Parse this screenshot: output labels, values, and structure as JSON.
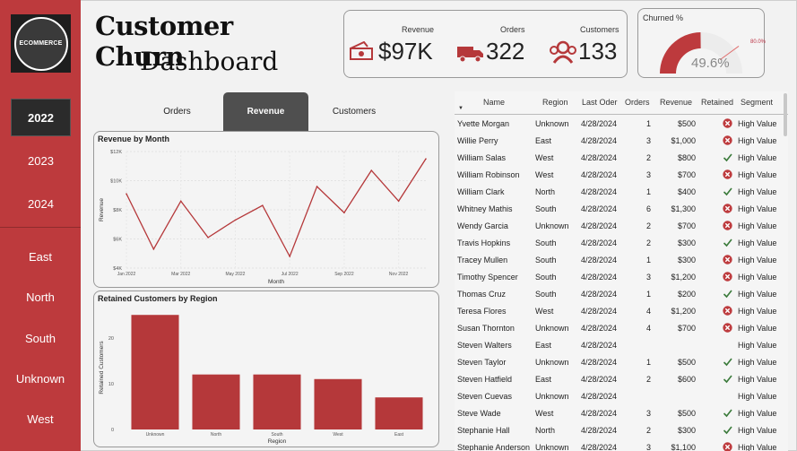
{
  "logo": {
    "text": "ECOMMERCE"
  },
  "sidebar": {
    "years": [
      "2022",
      "2023",
      "2024"
    ],
    "active_year": "2022",
    "regions": [
      "East",
      "North",
      "South",
      "Unknown",
      "West"
    ]
  },
  "title": {
    "main": "Customer Churn",
    "sub": "Dashboard"
  },
  "kpis": {
    "revenue": {
      "label": "Revenue",
      "value": "$97K",
      "icon": "money-icon"
    },
    "orders": {
      "label": "Orders",
      "value": "322",
      "icon": "truck-icon"
    },
    "customers": {
      "label": "Customers",
      "value": "133",
      "icon": "people-icon"
    }
  },
  "churn": {
    "title": "Churned %",
    "value": "49.6%",
    "target_label": "80.0%",
    "fraction": 0.496,
    "target_fraction": 0.8
  },
  "tabs": [
    "Orders",
    "Revenue",
    "Customers"
  ],
  "active_tab": "Revenue",
  "colors": {
    "accent": "#bd3a3d",
    "chart": "#b5383a",
    "check": "#3a7a3a"
  },
  "revenue_chart": {
    "title": "Revenue by Month",
    "chart_data": {
      "type": "line",
      "title": "Revenue by Month",
      "xlabel": "Month",
      "ylabel": "Revenue",
      "x": [
        "Jan 2022",
        "Feb 2022",
        "Mar 2022",
        "Apr 2022",
        "May 2022",
        "Jun 2022",
        "Jul 2022",
        "Aug 2022",
        "Sep 2022",
        "Oct 2022",
        "Nov 2022",
        "Dec 2022"
      ],
      "x_ticks": [
        "Jan 2022",
        "Mar 2022",
        "May 2022",
        "Jul 2022",
        "Sep 2022",
        "Nov 2022"
      ],
      "y_ticks": [
        "$4K",
        "$6K",
        "$8K",
        "$10K",
        "$12K"
      ],
      "values": [
        9100,
        5300,
        8600,
        6100,
        7300,
        8300,
        4800,
        9600,
        7800,
        10700,
        8600,
        11500
      ],
      "ylim": [
        4000,
        12000
      ],
      "grid": true
    }
  },
  "region_chart": {
    "title": "Retained Customers by Region",
    "chart_data": {
      "type": "bar",
      "title": "Retained Customers by Region",
      "xlabel": "Region",
      "ylabel": "Retained Customers",
      "categories": [
        "Unknown",
        "North",
        "South",
        "West",
        "East"
      ],
      "values": [
        25,
        12,
        12,
        11,
        7
      ],
      "y_ticks": [
        "0",
        "10",
        "20"
      ],
      "ylim": [
        0,
        27
      ]
    }
  },
  "table": {
    "headers": [
      "Name",
      "Region",
      "Last Oder",
      "Orders",
      "Revenue",
      "Retained",
      "Segment"
    ],
    "rows": [
      {
        "name": "Yvette Morgan",
        "region": "Unknown",
        "date": "4/28/2024",
        "orders": "1",
        "revenue": "$500",
        "retained": "no",
        "segment": "High Value"
      },
      {
        "name": "Willie Perry",
        "region": "East",
        "date": "4/28/2024",
        "orders": "3",
        "revenue": "$1,000",
        "retained": "no",
        "segment": "High Value"
      },
      {
        "name": "William Salas",
        "region": "West",
        "date": "4/28/2024",
        "orders": "2",
        "revenue": "$800",
        "retained": "yes",
        "segment": "High Value"
      },
      {
        "name": "William Robinson",
        "region": "West",
        "date": "4/28/2024",
        "orders": "3",
        "revenue": "$700",
        "retained": "no",
        "segment": "High Value"
      },
      {
        "name": "William Clark",
        "region": "North",
        "date": "4/28/2024",
        "orders": "1",
        "revenue": "$400",
        "retained": "yes",
        "segment": "High Value"
      },
      {
        "name": "Whitney Mathis",
        "region": "South",
        "date": "4/28/2024",
        "orders": "6",
        "revenue": "$1,300",
        "retained": "no",
        "segment": "High Value"
      },
      {
        "name": "Wendy Garcia",
        "region": "Unknown",
        "date": "4/28/2024",
        "orders": "2",
        "revenue": "$700",
        "retained": "no",
        "segment": "High Value"
      },
      {
        "name": "Travis Hopkins",
        "region": "South",
        "date": "4/28/2024",
        "orders": "2",
        "revenue": "$300",
        "retained": "yes",
        "segment": "High Value"
      },
      {
        "name": "Tracey Mullen",
        "region": "South",
        "date": "4/28/2024",
        "orders": "1",
        "revenue": "$300",
        "retained": "no",
        "segment": "High Value"
      },
      {
        "name": "Timothy Spencer",
        "region": "South",
        "date": "4/28/2024",
        "orders": "3",
        "revenue": "$1,200",
        "retained": "no",
        "segment": "High Value"
      },
      {
        "name": "Thomas Cruz",
        "region": "South",
        "date": "4/28/2024",
        "orders": "1",
        "revenue": "$200",
        "retained": "yes",
        "segment": "High Value"
      },
      {
        "name": "Teresa Flores",
        "region": "West",
        "date": "4/28/2024",
        "orders": "4",
        "revenue": "$1,200",
        "retained": "no",
        "segment": "High Value"
      },
      {
        "name": "Susan Thornton",
        "region": "Unknown",
        "date": "4/28/2024",
        "orders": "4",
        "revenue": "$700",
        "retained": "no",
        "segment": "High Value"
      },
      {
        "name": "Steven Walters",
        "region": "East",
        "date": "4/28/2024",
        "orders": "",
        "revenue": "",
        "retained": "",
        "segment": "High Value"
      },
      {
        "name": "Steven Taylor",
        "region": "Unknown",
        "date": "4/28/2024",
        "orders": "1",
        "revenue": "$500",
        "retained": "yes",
        "segment": "High Value"
      },
      {
        "name": "Steven Hatfield",
        "region": "East",
        "date": "4/28/2024",
        "orders": "2",
        "revenue": "$600",
        "retained": "yes",
        "segment": "High Value"
      },
      {
        "name": "Steven Cuevas",
        "region": "Unknown",
        "date": "4/28/2024",
        "orders": "",
        "revenue": "",
        "retained": "",
        "segment": "High Value"
      },
      {
        "name": "Steve Wade",
        "region": "West",
        "date": "4/28/2024",
        "orders": "3",
        "revenue": "$500",
        "retained": "yes",
        "segment": "High Value"
      },
      {
        "name": "Stephanie Hall",
        "region": "North",
        "date": "4/28/2024",
        "orders": "2",
        "revenue": "$300",
        "retained": "yes",
        "segment": "High Value"
      },
      {
        "name": "Stephanie Anderson",
        "region": "Unknown",
        "date": "4/28/2024",
        "orders": "3",
        "revenue": "$1,100",
        "retained": "no",
        "segment": "High Value"
      }
    ]
  }
}
